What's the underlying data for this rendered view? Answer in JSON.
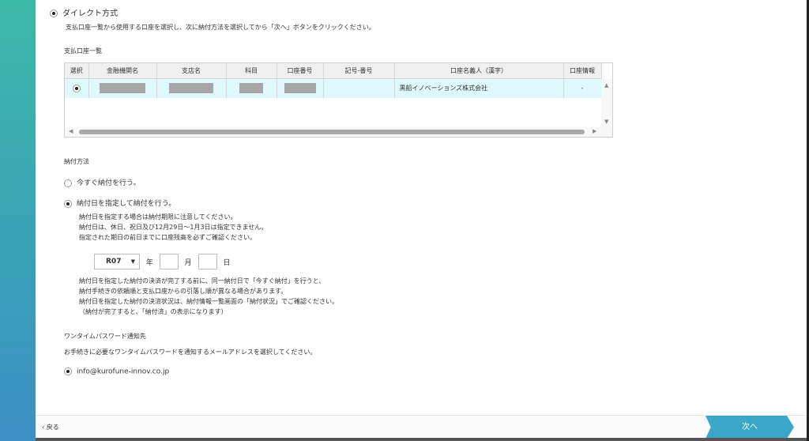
{
  "direct": {
    "title": "ダイレクト方式",
    "description": "支払口座一覧から使用する口座を選択し、次に納付方法を選択してから「次へ」ボタンをクリックください。"
  },
  "accounts": {
    "label": "支払口座一覧",
    "columns": [
      "選択",
      "金融機関名",
      "支店名",
      "科目",
      "口座番号",
      "記号-番号",
      "口座名義人（漢字）",
      "口座情報"
    ],
    "rows": [
      {
        "holder": "黒船イノベーションズ株式会社",
        "info": "-"
      }
    ]
  },
  "payment": {
    "label": "納付方法",
    "option_now": "今すぐ納付を行う。",
    "option_date": "納付日を指定して納付を行う。",
    "note_lines": [
      "納付日を指定する場合は納付期限に注意してください。",
      "納付日は、休日、祝日及び12月29日～1月3日は指定できません。",
      "指定された期日の前日までに口座残高を必ずご確認ください。"
    ],
    "era": "R07",
    "unit_year": "年",
    "unit_month": "月",
    "unit_day": "日",
    "note2_lines": [
      "納付日を指定した納付の決済が完了する前に、同一納付日で「今すぐ納付」を行うと、",
      "納付手続きの依頼順と支払口座からの引落し順が異なる場合があります。",
      "納付日を指定した納付の決済状況は、納付情報一覧画面の「納付状況」でご確認ください。",
      "（納付が完了すると、「納付済」の表示になります）"
    ]
  },
  "otp": {
    "label": "ワンタイムパスワード通知先",
    "description": "お手続きに必要なワンタイムパスワードを通知するメールアドレスを選択してください。",
    "email": "info@kurofune-innov.co.jp"
  },
  "footer": {
    "back": "戻る",
    "next": "次へ"
  },
  "colors": {
    "accent": "#3aa6c8",
    "row_selected": "#dff8fb"
  }
}
